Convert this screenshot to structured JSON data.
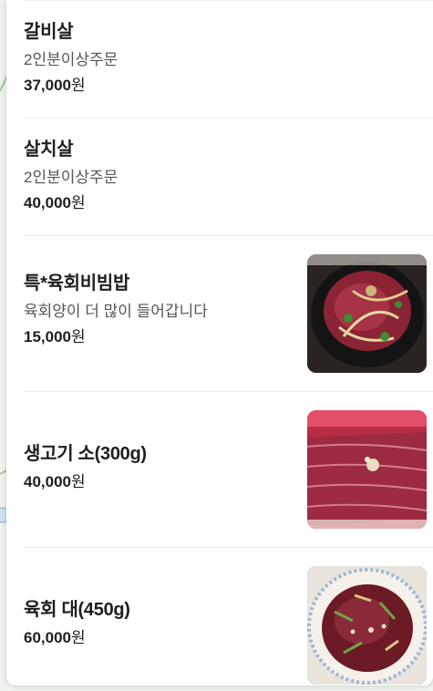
{
  "menu": {
    "items": [
      {
        "name": "갈비살",
        "description": "2인분이상주문",
        "price": "37,000",
        "currency": "원",
        "has_photo": false
      },
      {
        "name": "살치살",
        "description": "2인분이상주문",
        "price": "40,000",
        "currency": "원",
        "has_photo": false
      },
      {
        "name": "특*육회비빔밥",
        "description": "육회양이 더 많이 들어갑니다",
        "price": "15,000",
        "currency": "원",
        "has_photo": true,
        "photo_icon": "bibimbap-photo"
      },
      {
        "name": "생고기 소(300g)",
        "description": "",
        "price": "40,000",
        "currency": "원",
        "has_photo": true,
        "photo_icon": "raw-beef-photo"
      },
      {
        "name": "육회 대(450g)",
        "description": "",
        "price": "60,000",
        "currency": "원",
        "has_photo": true,
        "photo_icon": "yukhoe-photo"
      }
    ]
  },
  "colors": {
    "panel_bg": "#ffffff",
    "text_primary": "#1e1e1e",
    "text_secondary": "#555555",
    "divider": "#ececec",
    "map_bg": "#eef3ec"
  }
}
